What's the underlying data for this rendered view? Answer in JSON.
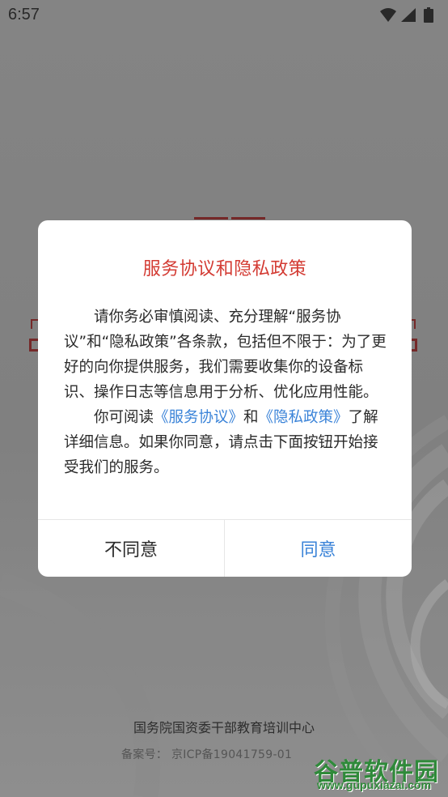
{
  "status_bar": {
    "time": "6:57",
    "icons": [
      "wifi-icon",
      "signal-icon",
      "battery-icon"
    ]
  },
  "dialog": {
    "title": "服务协议和隐私政策",
    "paragraph1": "请你务必审慎阅读、充分理解“服务协议”和“隐私政策”各条款，包括但不限于：为了更好的向你提供服务，我们需要收集你的设备标识、操作日志等信息用于分析、优化应用性能。",
    "paragraph2": {
      "prefix": "你可阅读",
      "link1": "《服务协议》",
      "middle": "和",
      "link2": "《隐私政策》",
      "suffix": "了解详细信息。如果你同意，请点击下面按钮开始接受我们的服务。"
    },
    "disagree_label": "不同意",
    "agree_label": "同意"
  },
  "footer": {
    "organization": "国务院国资委干部教育培训中心",
    "icp": "备案号： 京ICP备19041759-01"
  },
  "watermark": {
    "name": "谷普软件园",
    "url": "www.gupuxiazai.com"
  },
  "colors": {
    "title": "#d33b33",
    "link": "#3a83d8",
    "agree": "#3a83d8",
    "watermark": "#2f8a3a"
  }
}
